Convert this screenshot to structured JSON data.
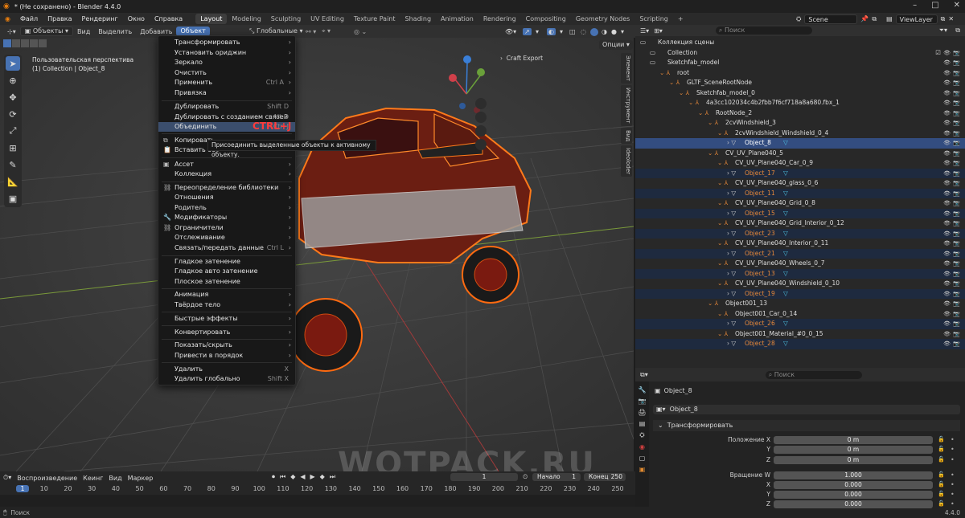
{
  "title": "* (Не сохранено) - Blender 4.4.0",
  "menus": [
    "Файл",
    "Правка",
    "Рендеринг",
    "Окно",
    "Справка"
  ],
  "workspaces": [
    "Layout",
    "Modeling",
    "Sculpting",
    "UV Editing",
    "Texture Paint",
    "Shading",
    "Animation",
    "Rendering",
    "Compositing",
    "Geometry Nodes",
    "Scripting"
  ],
  "add_tab": "+",
  "scene": "Scene",
  "view_layer": "ViewLayer",
  "viewport_header": {
    "mode": "Объекты",
    "view": "Вид",
    "select": "Выделить",
    "add": "Добавить",
    "object": "Объект",
    "transform": "Глобальные",
    "options": "Опции"
  },
  "viewport": {
    "perspective": "Пользовательская перспектива",
    "collection_line": "(1) Collection | Object_8",
    "craft_export": "Craft Export"
  },
  "object_menu": [
    {
      "label": "Трансформировать",
      "arrow": "›"
    },
    {
      "label": "Установить ориджин",
      "arrow": "›"
    },
    {
      "label": "Зеркало",
      "arrow": "›"
    },
    {
      "label": "Очистить",
      "arrow": "›"
    },
    {
      "label": "Применить",
      "shortcut": "Ctrl A",
      "arrow": "›"
    },
    {
      "label": "Привязка",
      "arrow": "›"
    },
    {
      "label": "Дублировать",
      "shortcut": "Shift D"
    },
    {
      "label": "Дублировать с созданием связей",
      "shortcut": "Alt D"
    },
    {
      "label": "Объединить",
      "shortcut": "Ctrl J"
    },
    {
      "label": "Копировать"
    },
    {
      "label": "Вставить об"
    },
    {
      "label": "Ассет",
      "arrow": "›"
    },
    {
      "label": "Коллекция",
      "arrow": "›"
    },
    {
      "label": "Переопределение библиотеки",
      "arrow": "›"
    },
    {
      "label": "Отношения",
      "arrow": "›"
    },
    {
      "label": "Родитель",
      "arrow": "›"
    },
    {
      "label": "Модификаторы",
      "arrow": "›"
    },
    {
      "label": "Ограничители",
      "arrow": "›"
    },
    {
      "label": "Отслеживание",
      "arrow": "›"
    },
    {
      "label": "Связать/передать данные",
      "shortcut": "Ctrl L",
      "arrow": "›"
    },
    {
      "label": "Гладкое затенение"
    },
    {
      "label": "Гладкое авто затенение"
    },
    {
      "label": "Плоское затенение"
    },
    {
      "label": "Анимация",
      "arrow": "›"
    },
    {
      "label": "Твёрдое тело",
      "arrow": "›"
    },
    {
      "label": "Быстрые эффекты",
      "arrow": "›"
    },
    {
      "label": "Конвертировать",
      "arrow": "›"
    },
    {
      "label": "Показать/скрыть",
      "arrow": "›"
    },
    {
      "label": "Привести в порядок",
      "arrow": "›"
    },
    {
      "label": "Удалить",
      "shortcut": "X"
    },
    {
      "label": "Удалить глобально",
      "shortcut": "Shift X"
    }
  ],
  "tooltip": "Присоединить выделенные объекты к активному объекту.",
  "ctrl_badge": "CTRL+J",
  "npanel_tabs": [
    "Элемент",
    "Инструмент",
    "Вид",
    "Ideoloder"
  ],
  "timeline": {
    "playback": "Воспроизведение",
    "keying": "Кеинг",
    "view": "Вид",
    "marker": "Маркер",
    "current_frame": "1",
    "start_label": "Начало",
    "start": "1",
    "end_label": "Конец",
    "end": "250",
    "ticks": [
      "1",
      "10",
      "20",
      "30",
      "40",
      "50",
      "60",
      "70",
      "80",
      "90",
      "100",
      "110",
      "120",
      "130",
      "140",
      "150",
      "160",
      "170",
      "180",
      "190",
      "200",
      "210",
      "220",
      "230",
      "240",
      "250"
    ]
  },
  "status": {
    "search": "Поиск",
    "version": "4.4.0"
  },
  "watermark": "WOTPACK.RU",
  "outliner": {
    "search_placeholder": "Поиск",
    "rows": [
      {
        "label": "Коллекция сцены",
        "depth": 0
      },
      {
        "label": "Collection",
        "depth": 1
      },
      {
        "label": "Sketchfab_model",
        "depth": 1
      },
      {
        "label": "root",
        "depth": 2
      },
      {
        "label": "GLTF_SceneRootNode",
        "depth": 3
      },
      {
        "label": "Sketchfab_model_0",
        "depth": 4
      },
      {
        "label": "4a3cc102034c4b2fbb7f6cf718a8a680.fbx_1",
        "depth": 5
      },
      {
        "label": "RootNode_2",
        "depth": 6
      },
      {
        "label": "2cvWindshield_3",
        "depth": 7
      },
      {
        "label": "2cvWindshield_Windshield_0_4",
        "depth": 8
      },
      {
        "label": "Object_8",
        "depth": 9,
        "selected": true
      },
      {
        "label": "CV_UV_Plane040_5",
        "depth": 7
      },
      {
        "label": "CV_UV_Plane040_Car_0_9",
        "depth": 8
      },
      {
        "label": "Object_17",
        "depth": 9
      },
      {
        "label": "CV_UV_Plane040_glass_0_6",
        "depth": 8
      },
      {
        "label": "Object_11",
        "depth": 9
      },
      {
        "label": "CV_UV_Plane040_Grid_0_8",
        "depth": 8
      },
      {
        "label": "Object_15",
        "depth": 9
      },
      {
        "label": "CV_UV_Plane040_Grid_Interior_0_12",
        "depth": 8
      },
      {
        "label": "Object_23",
        "depth": 9
      },
      {
        "label": "CV_UV_Plane040_Interior_0_11",
        "depth": 8
      },
      {
        "label": "Object_21",
        "depth": 9
      },
      {
        "label": "CV_UV_Plane040_Wheels_0_7",
        "depth": 8
      },
      {
        "label": "Object_13",
        "depth": 9
      },
      {
        "label": "CV_UV_Plane040_Windshield_0_10",
        "depth": 8
      },
      {
        "label": "Object_19",
        "depth": 9
      },
      {
        "label": "Object001_13",
        "depth": 7
      },
      {
        "label": "Object001_Car_0_14",
        "depth": 8
      },
      {
        "label": "Object_26",
        "depth": 9
      },
      {
        "label": "Object001_Material_#0_0_15",
        "depth": 8
      },
      {
        "label": "Object_28",
        "depth": 9
      }
    ]
  },
  "properties": {
    "search_placeholder": "Поиск",
    "object_name": "Object_8",
    "data_name": "Object_8",
    "section": "Трансформировать",
    "fields": [
      {
        "label": "Положение X",
        "value": "0 m"
      },
      {
        "label": "Y",
        "value": "0 m"
      },
      {
        "label": "Z",
        "value": "0 m"
      },
      {
        "label": "Вращение W",
        "value": "1.000"
      },
      {
        "label": "X",
        "value": "0.000"
      },
      {
        "label": "Y",
        "value": "0.000"
      },
      {
        "label": "Z",
        "value": "0.000"
      }
    ]
  }
}
